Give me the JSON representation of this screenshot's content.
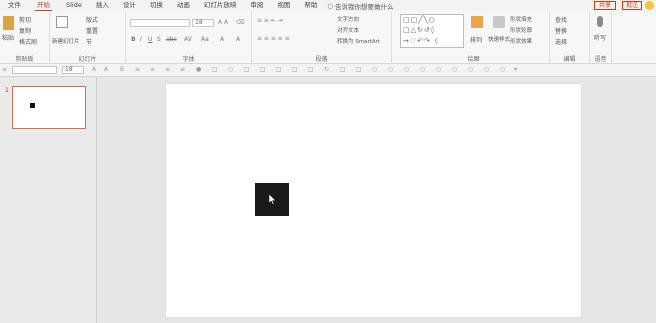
{
  "tabs": [
    "文件",
    "开始",
    "Slide",
    "插入",
    "设计",
    "切换",
    "动画",
    "幻灯片放映",
    "审阅",
    "视图",
    "帮助"
  ],
  "active_tab_index": 1,
  "tell_me": "告诉我你想要做什么",
  "share": "共享",
  "comment": "批注",
  "ribbon": {
    "clipboard": {
      "label": "剪贴板",
      "paste": "粘贴",
      "cut": "剪切",
      "copy": "复制",
      "format": "格式刷"
    },
    "slides": {
      "label": "幻灯片",
      "new": "新建幻灯片",
      "layout": "版式",
      "reset": "重置",
      "section": "节"
    },
    "font": {
      "label": "字体",
      "size": "18"
    },
    "paragraph": {
      "label": "段落",
      "direction": "文字方向",
      "align": "对齐文本",
      "smartart": "转换为 SmartArt"
    },
    "drawing": {
      "label": "绘图",
      "arrange": "排列",
      "quick_styles": "快速样式",
      "fill": "形状填充",
      "outline": "形状轮廓",
      "effect": "形状效果"
    },
    "editing": {
      "label": "编辑",
      "find": "查找",
      "replace": "替换",
      "select": "选择"
    },
    "voice": {
      "label": "语音",
      "dictate": "听写"
    }
  },
  "qbar": {
    "size": "18"
  },
  "slide_number": "1"
}
